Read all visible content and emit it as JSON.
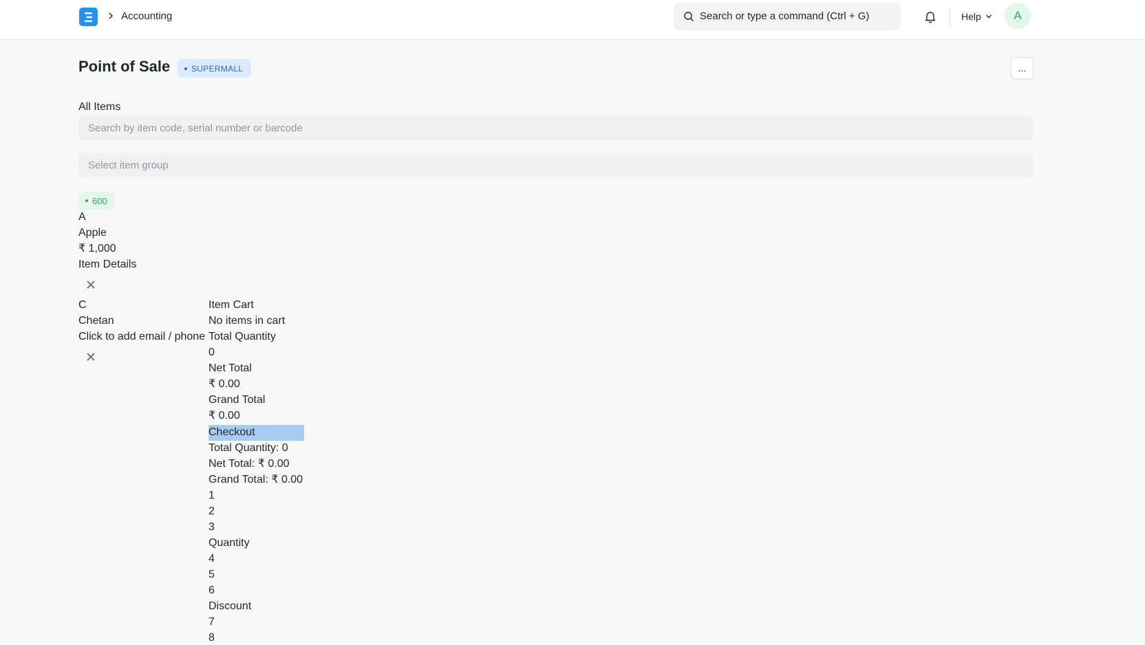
{
  "navbar": {
    "breadcrumb": "Accounting",
    "search_text": "Search or type a command (Ctrl + G)",
    "help_label": "Help",
    "avatar_initial": "A"
  },
  "page": {
    "title": "Point of Sale",
    "profile_badge": "SUPERMALL",
    "more_label": "..."
  },
  "items": {
    "heading": "All Items",
    "search_placeholder": "Search by item code, serial number or barcode",
    "group_placeholder": "Select item group",
    "list": [
      {
        "stock": "600",
        "initial": "A",
        "name": "Apple",
        "price": "₹ 1,000"
      }
    ]
  },
  "item_details": {
    "heading": "Item Details"
  },
  "customer": {
    "initial": "C",
    "name": "Chetan",
    "contact_prompt": "Click to add email / phone"
  },
  "cart": {
    "heading": "Item Cart",
    "empty_text": "No items in cart",
    "total_qty_label": "Total Quantity",
    "total_qty_value": "0",
    "net_total_label": "Net Total",
    "net_total_value": "₹ 0.00",
    "grand_total_label": "Grand Total",
    "grand_total_value": "₹ 0.00",
    "checkout_label": "Checkout",
    "summary_qty": "Total Quantity: 0",
    "summary_net": "Net Total: ₹ 0.00",
    "summary_grand": "Grand Total: ₹ 0.00"
  },
  "numpad": {
    "keys": [
      "1",
      "2",
      "3",
      "Quantity",
      "4",
      "5",
      "6",
      "Discount",
      "7",
      "8"
    ]
  },
  "colors": {
    "accent": "#2490ef",
    "badge_bg": "#dbeafe",
    "stock_green": "#30a66d",
    "checkout_highlight": "#a8ccf0"
  }
}
